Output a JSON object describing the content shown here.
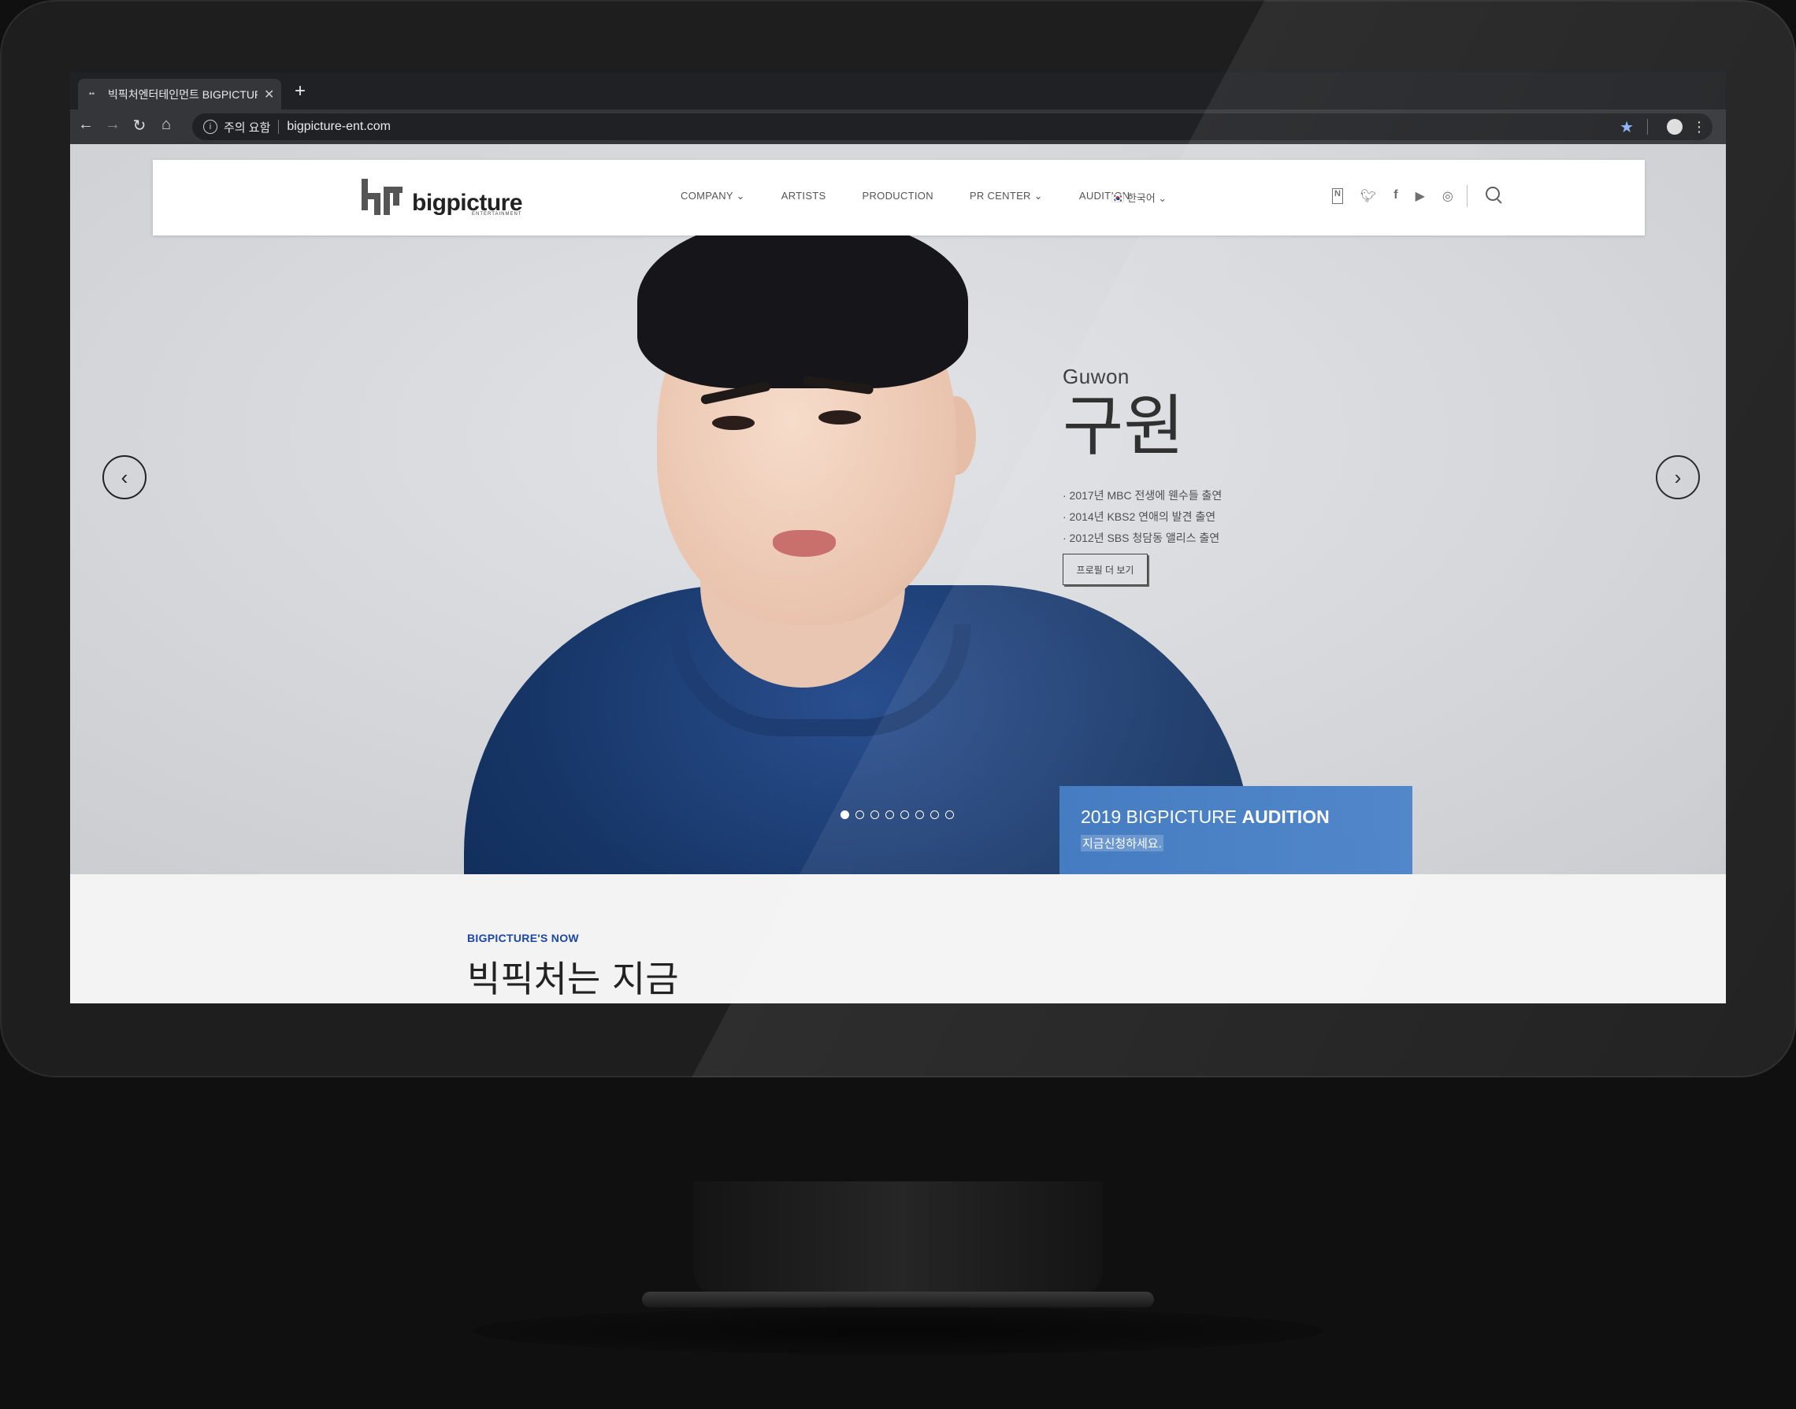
{
  "browser": {
    "tab_title": "빅픽처엔터테인먼트 BIGPICTURE E",
    "tab_close": "✕",
    "new_tab": "+",
    "security_label": "주의 요함",
    "url": "bigpicture-ent.com"
  },
  "site": {
    "logo_text": "bigpicture",
    "logo_sub": "ENTERTAINMENT",
    "menu": [
      "COMPANY ⌄",
      "ARTISTS",
      "PRODUCTION",
      "PR CENTER ⌄",
      "AUDITION"
    ],
    "language": "한국어 ⌄",
    "social_icons": [
      "naver-icon",
      "twitter-icon",
      "facebook-icon",
      "youtube-icon",
      "instagram-icon"
    ]
  },
  "slide": {
    "english_name": "Guwon",
    "korean_name": "구원",
    "credits": [
      "· 2017년 MBC 전생에 웬수들 출연",
      "· 2014년 KBS2 연애의 발견 출연",
      "· 2012년 SBS 청담동 앨리스 출연"
    ],
    "profile_button": "프로필 더 보기",
    "total_slides": 8,
    "active_slide": 1
  },
  "audition": {
    "title_prefix": "2019 BIGPICTURE ",
    "title_bold": "AUDITION",
    "subtitle": "지금신청하세요."
  },
  "now_section": {
    "label": "BIGPICTURE'S NOW",
    "title": "빅픽처는 지금"
  },
  "colors": {
    "accent_blue": "#1b46a6",
    "audition_bg": "#3a74bd",
    "browser_dark": "#35363a"
  }
}
